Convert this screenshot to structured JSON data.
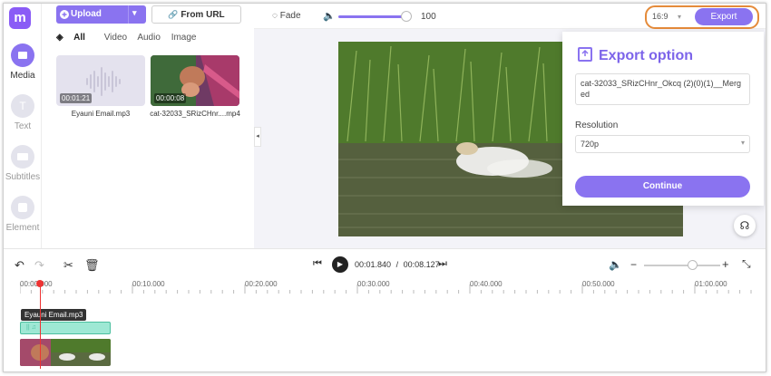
{
  "app": {
    "logo_letter": "m"
  },
  "sidebar": {
    "items": [
      {
        "label": "Media",
        "icon": "folder-icon",
        "active": true
      },
      {
        "label": "Text",
        "icon": "text-icon",
        "active": false
      },
      {
        "label": "Subtitles",
        "icon": "subtitles-icon",
        "active": false
      },
      {
        "label": "Element",
        "icon": "element-icon",
        "active": false
      }
    ]
  },
  "media": {
    "upload_label": "Upload",
    "from_url_label": "From URL",
    "tabs": [
      "All",
      "Video",
      "Audio",
      "Image"
    ],
    "active_tab": "All",
    "files": [
      {
        "name": "Eyauni Email.mp3",
        "duration": "00:01:21",
        "type": "audio"
      },
      {
        "name": "cat-32033_SRizCHnr....mp4",
        "duration": "00:00:08",
        "type": "video"
      }
    ]
  },
  "toolbar": {
    "fade_label": "Fade",
    "volume_value": "100",
    "volume_level": 1.0
  },
  "export": {
    "ratio": "16:9",
    "export_label": "Export",
    "panel_title": "Export option",
    "filename": "cat-32033_SRizCHnr_Okcq (2)(0)(1)__Merged",
    "resolution_label": "Resolution",
    "resolution_value": "720p",
    "continue_label": "Continue"
  },
  "player": {
    "current_time": "00:01.840",
    "separator": "/",
    "total_time": "00:08.127"
  },
  "timeline": {
    "ruler_labels": [
      "00:00.000",
      "00:10.000",
      "00:20.000",
      "00:30.000",
      "00:40.000",
      "00:50.000",
      "01:00.000"
    ],
    "tooltip": "Eyauni Email.mp3"
  },
  "colors": {
    "accent": "#8a73f0",
    "highlight": "#e58b3a",
    "playhead": "#e33333"
  }
}
